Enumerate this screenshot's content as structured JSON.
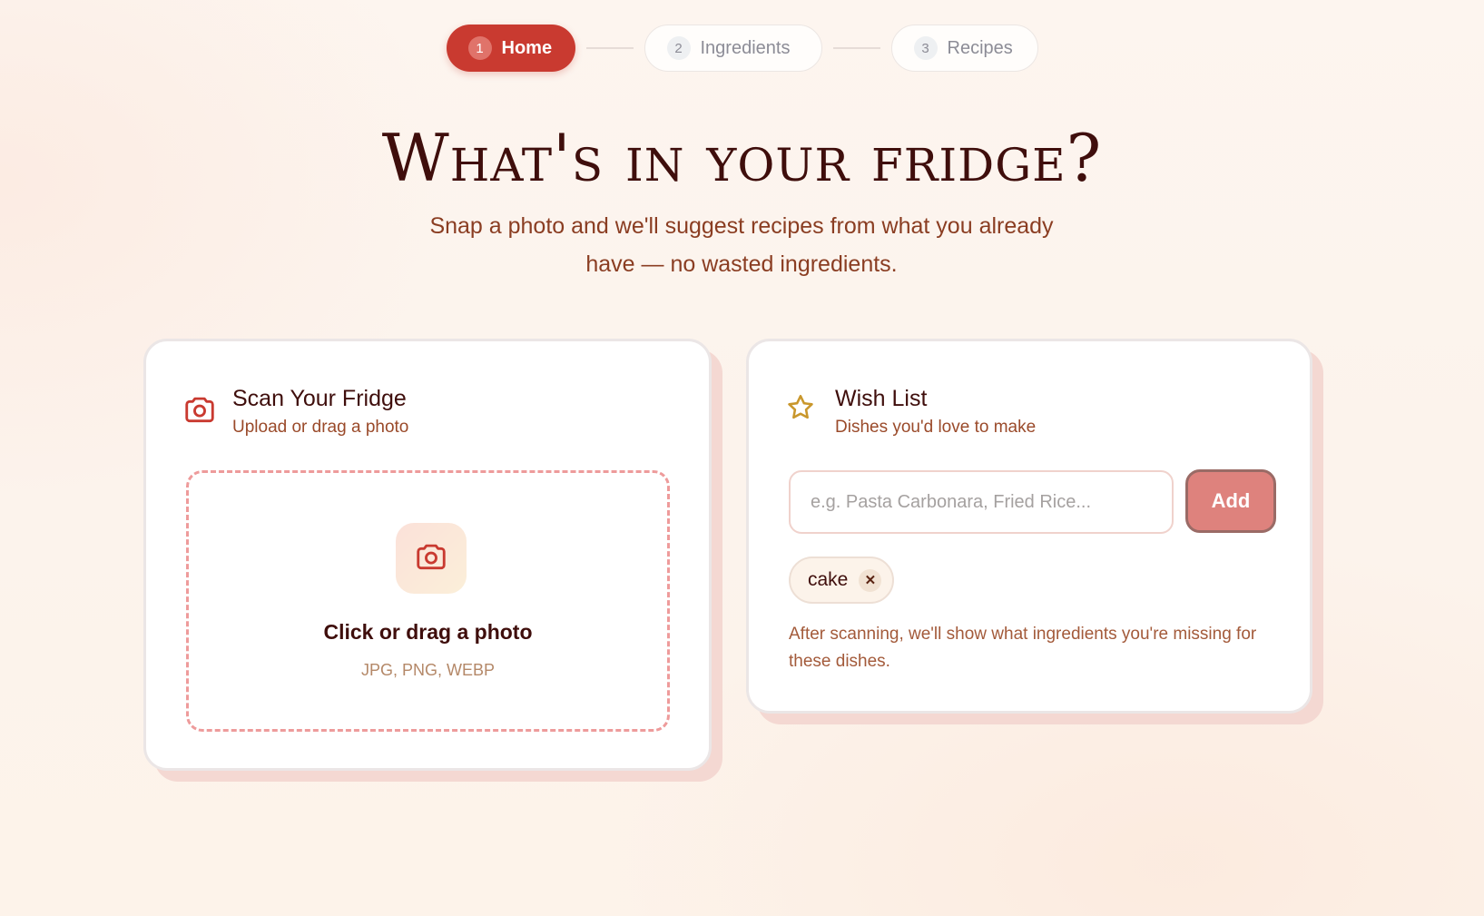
{
  "stepper": {
    "steps": [
      {
        "num": "1",
        "label": "Home",
        "active": true
      },
      {
        "num": "2",
        "label": "Ingredients",
        "active": false
      },
      {
        "num": "3",
        "label": "Recipes",
        "active": false
      }
    ]
  },
  "hero": {
    "title": "What's in your fridge?",
    "subtitle": "Snap a photo and we'll suggest recipes from what you already have — no wasted ingredients."
  },
  "scan_card": {
    "icon": "camera-icon",
    "title": "Scan Your Fridge",
    "subtitle": "Upload or drag a photo",
    "dropzone": {
      "icon": "camera-icon",
      "title": "Click or drag a photo",
      "formats": "JPG, PNG, WEBP"
    }
  },
  "wish_card": {
    "icon": "star-icon",
    "title": "Wish List",
    "subtitle": "Dishes you'd love to make",
    "input": {
      "value": "",
      "placeholder": "e.g. Pasta Carbonara, Fried Rice..."
    },
    "add_label": "Add",
    "tags": [
      {
        "label": "cake",
        "remove_icon": "close-icon"
      }
    ],
    "note": "After scanning, we'll show what ingredients you're missing for these dishes."
  },
  "colors": {
    "accent": "#c93a30",
    "title": "#3f0e0c",
    "subtitle": "#8a3d22",
    "star": "#c9972c",
    "add_button": "#de827d"
  }
}
